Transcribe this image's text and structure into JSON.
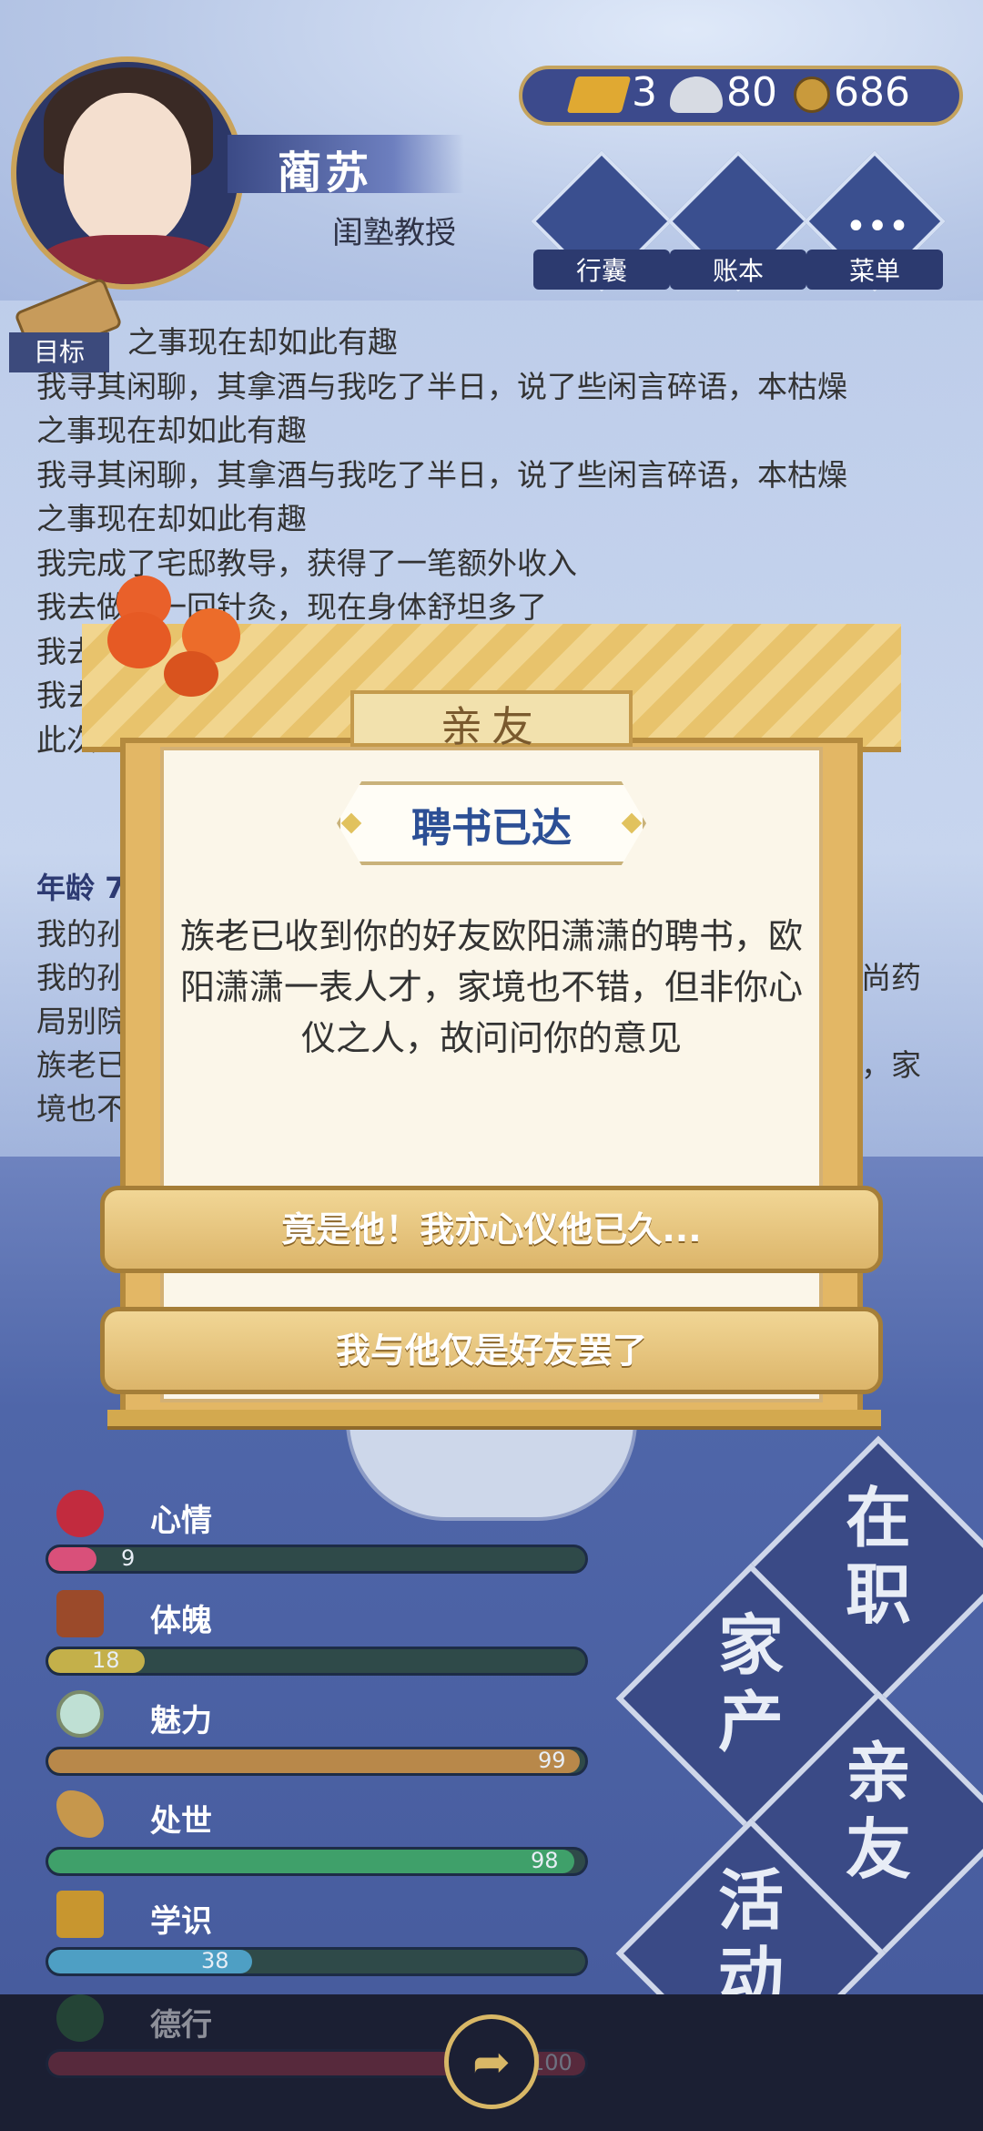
{
  "character": {
    "name": "蔺苏",
    "title": "闺塾教授"
  },
  "currency": {
    "gold": "3",
    "silver": "80",
    "coin": "686"
  },
  "menu": {
    "bag_label": "行囊",
    "ledger_label": "账本",
    "menu_label": "菜单"
  },
  "target_label": "目标",
  "log": [
    "我寻其闲聊，其拿酒与我吃了半日，说了些闲言碎语，本枯燥",
    "之事现在却如此有趣",
    "我寻其闲聊，其拿酒与我吃了半日，说了些闲言碎语，本枯燥",
    "之事现在却如此有趣",
    "我寻其闲聊，其拿酒与我吃了半日，说了些闲言碎语，本枯燥",
    "之事现在却如此有趣",
    "我完成了宅邸教导，获得了一笔额外收入",
    "我去做了一回针灸，现在身体舒坦多了",
    "我去",
    "我去",
    "此次"
  ],
  "age_label": "年龄 7",
  "log2": [
    "我的孙",
    "我的孙",
    "局别院",
    "族老已",
    "境也不"
  ],
  "log2_right": [
    "尚药",
    "，家"
  ],
  "modal": {
    "header": "亲友",
    "title": "聘书已达",
    "body": "族老已收到你的好友欧阳潇潇的聘书，欧阳潇潇一表人才，家境也不错，但非你心仪之人，故问问你的意见",
    "choice_1": "竟是他！我亦心仪他已久...",
    "choice_2": "我与他仅是好友罢了"
  },
  "stats": [
    {
      "label": "心情",
      "value": "9",
      "fraction": 0.09,
      "color": "#d9507a"
    },
    {
      "label": "体魄",
      "value": "18",
      "fraction": 0.18,
      "color": "#c4b04a"
    },
    {
      "label": "魅力",
      "value": "99",
      "fraction": 0.99,
      "color": "#b8884a"
    },
    {
      "label": "处世",
      "value": "98",
      "fraction": 0.98,
      "color": "#3fa06a"
    },
    {
      "label": "学识",
      "value": "38",
      "fraction": 0.38,
      "color": "#4e9fc4"
    },
    {
      "label": "德行",
      "value": "100",
      "fraction": 1.0,
      "color": "#b23a4a"
    }
  ],
  "tiles": {
    "work": "在职",
    "property": "家产",
    "friends": "亲友",
    "activity": "活动"
  }
}
